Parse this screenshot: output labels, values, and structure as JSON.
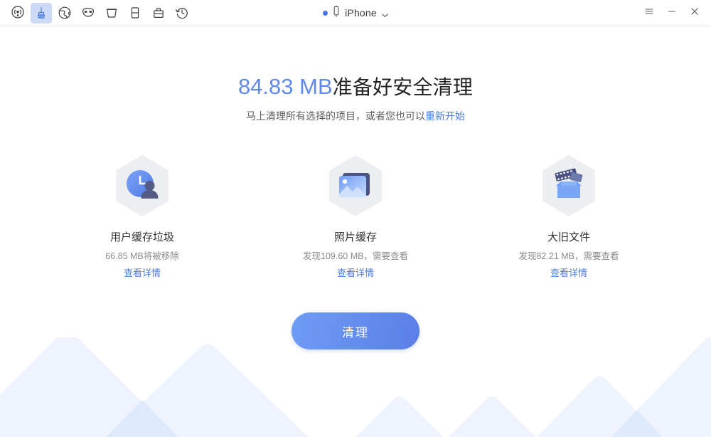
{
  "titlebar": {
    "tools": [
      {
        "name": "broadcast-icon",
        "label": "Connect"
      },
      {
        "name": "broom-icon",
        "label": "Clean",
        "active": true
      },
      {
        "name": "globe-icon",
        "label": "Browser"
      },
      {
        "name": "mask-icon",
        "label": "Privacy"
      },
      {
        "name": "trash-icon",
        "label": "Trash"
      },
      {
        "name": "device-icon",
        "label": "Device"
      },
      {
        "name": "toolbox-icon",
        "label": "Toolbox"
      },
      {
        "name": "history-icon",
        "label": "History"
      }
    ],
    "device": {
      "status_dot_color": "#4a6fe0",
      "device_icon": "iphone-icon",
      "name": "iPhone",
      "chevron": "chevron-down-icon"
    },
    "window": {
      "menu": "hamburger-menu-icon",
      "minimize": "minimize-icon",
      "close": "close-icon"
    }
  },
  "main": {
    "headline_amount": "84.83 MB",
    "headline_text": "准备好安全清理",
    "subhead_prefix": "马上清理所有选择的项目，或者您也可以",
    "subhead_link": "重新开始",
    "cards": [
      {
        "icon": "user-cache-clock-person-icon",
        "title": "用户缓存垃圾",
        "sub": "66.85 MB将被移除",
        "link": "查看详情"
      },
      {
        "icon": "photo-cache-image-icon",
        "title": "照片缓存",
        "sub": "发现109.60 MB，需要查看",
        "link": "查看详情"
      },
      {
        "icon": "large-old-files-box-icon",
        "title": "大旧文件",
        "sub": "发现82.21 MB，需要查看",
        "link": "查看详情"
      }
    ],
    "cta_label": "清理"
  },
  "colors": {
    "accent": "#4a7ce0",
    "amount": "#6189e8",
    "cta_start": "#6f9cf4",
    "cta_end": "#5a7fe8",
    "active_tool_bg": "#ccdaf5",
    "mountain_light": "#eef3fd",
    "mountain_mid": "#dbe7fb"
  }
}
